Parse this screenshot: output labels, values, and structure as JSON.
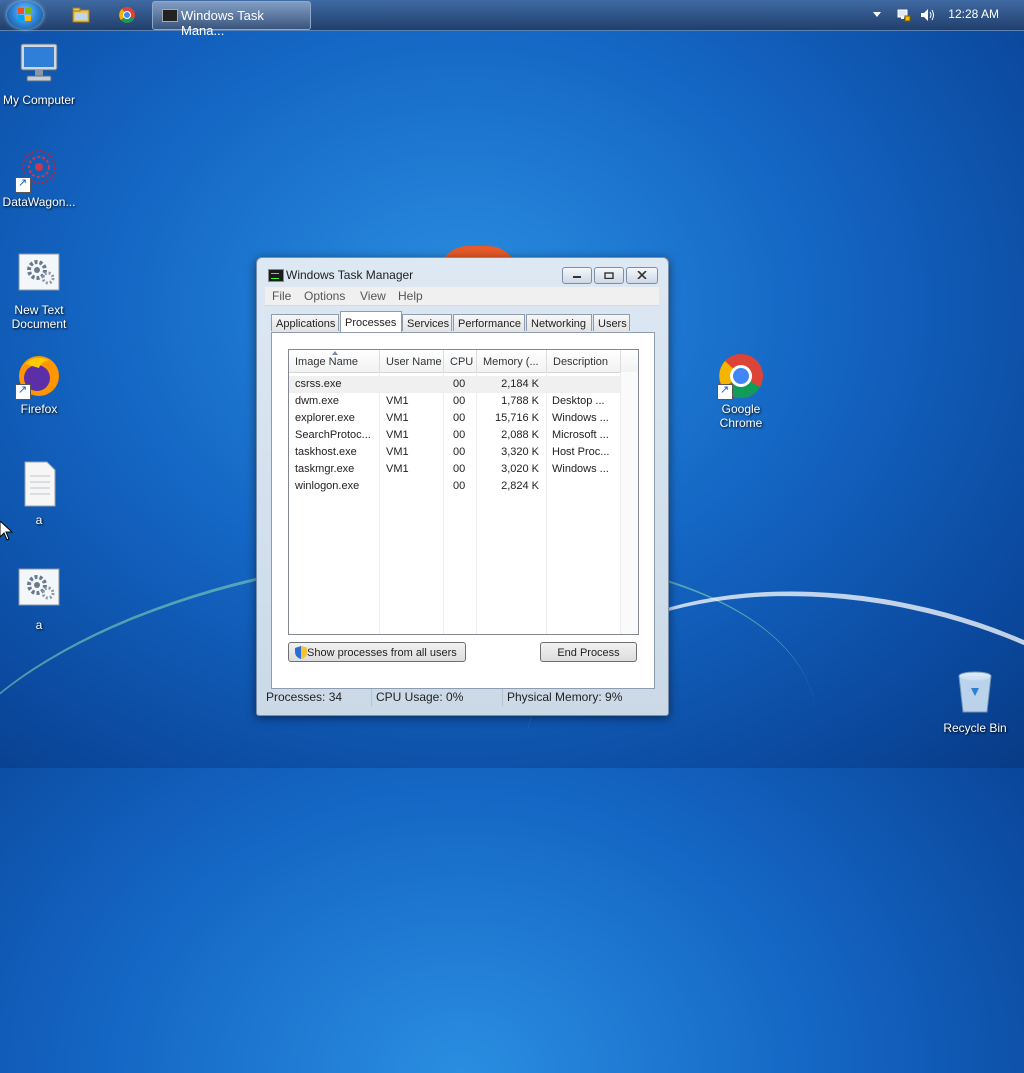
{
  "taskbar": {
    "task_label": "Windows Task Mana...",
    "clock": "12:28 AM"
  },
  "desktop": {
    "icons": [
      {
        "label": "My Computer",
        "icon": "computer-icon"
      },
      {
        "label": "DataWagon...",
        "icon": "datawagon-icon"
      },
      {
        "label": "New Text Document",
        "icon": "settings-document-icon"
      },
      {
        "label": "Firefox",
        "icon": "firefox-icon"
      },
      {
        "label": "a",
        "icon": "text-file-icon"
      },
      {
        "label": "a",
        "icon": "settings-document-icon"
      },
      {
        "label": "Google Chrome",
        "icon": "chrome-icon"
      },
      {
        "label": "Recycle Bin",
        "icon": "recycle-bin-icon"
      }
    ]
  },
  "window": {
    "title": "Windows Task Manager",
    "menu": [
      "File",
      "Options",
      "View",
      "Help"
    ],
    "tabs": [
      "Applications",
      "Processes",
      "Services",
      "Performance",
      "Networking",
      "Users"
    ],
    "active_tab": "Processes",
    "columns": [
      "Image Name",
      "User Name",
      "CPU",
      "Memory (...",
      "Description"
    ],
    "rows": [
      {
        "image": "csrss.exe",
        "user": "",
        "cpu": "00",
        "mem": "2,184 K",
        "desc": ""
      },
      {
        "image": "dwm.exe",
        "user": "VM1",
        "cpu": "00",
        "mem": "1,788 K",
        "desc": "Desktop ..."
      },
      {
        "image": "explorer.exe",
        "user": "VM1",
        "cpu": "00",
        "mem": "15,716 K",
        "desc": "Windows ..."
      },
      {
        "image": "SearchProtoc...",
        "user": "VM1",
        "cpu": "00",
        "mem": "2,088 K",
        "desc": "Microsoft ..."
      },
      {
        "image": "taskhost.exe",
        "user": "VM1",
        "cpu": "00",
        "mem": "3,320 K",
        "desc": "Host Proc..."
      },
      {
        "image": "taskmgr.exe",
        "user": "VM1",
        "cpu": "00",
        "mem": "3,020 K",
        "desc": "Windows ..."
      },
      {
        "image": "winlogon.exe",
        "user": "",
        "cpu": "00",
        "mem": "2,824 K",
        "desc": ""
      }
    ],
    "show_all_label": "Show processes from all users",
    "end_process_label": "End Process",
    "status": {
      "processes": "Processes: 34",
      "cpu": "CPU Usage: 0%",
      "memory": "Physical Memory: 9%"
    }
  },
  "colors": {
    "desktop": "#1466c4",
    "taskbar": "#2b4c7e",
    "window_frame": "#d4e0ec"
  }
}
